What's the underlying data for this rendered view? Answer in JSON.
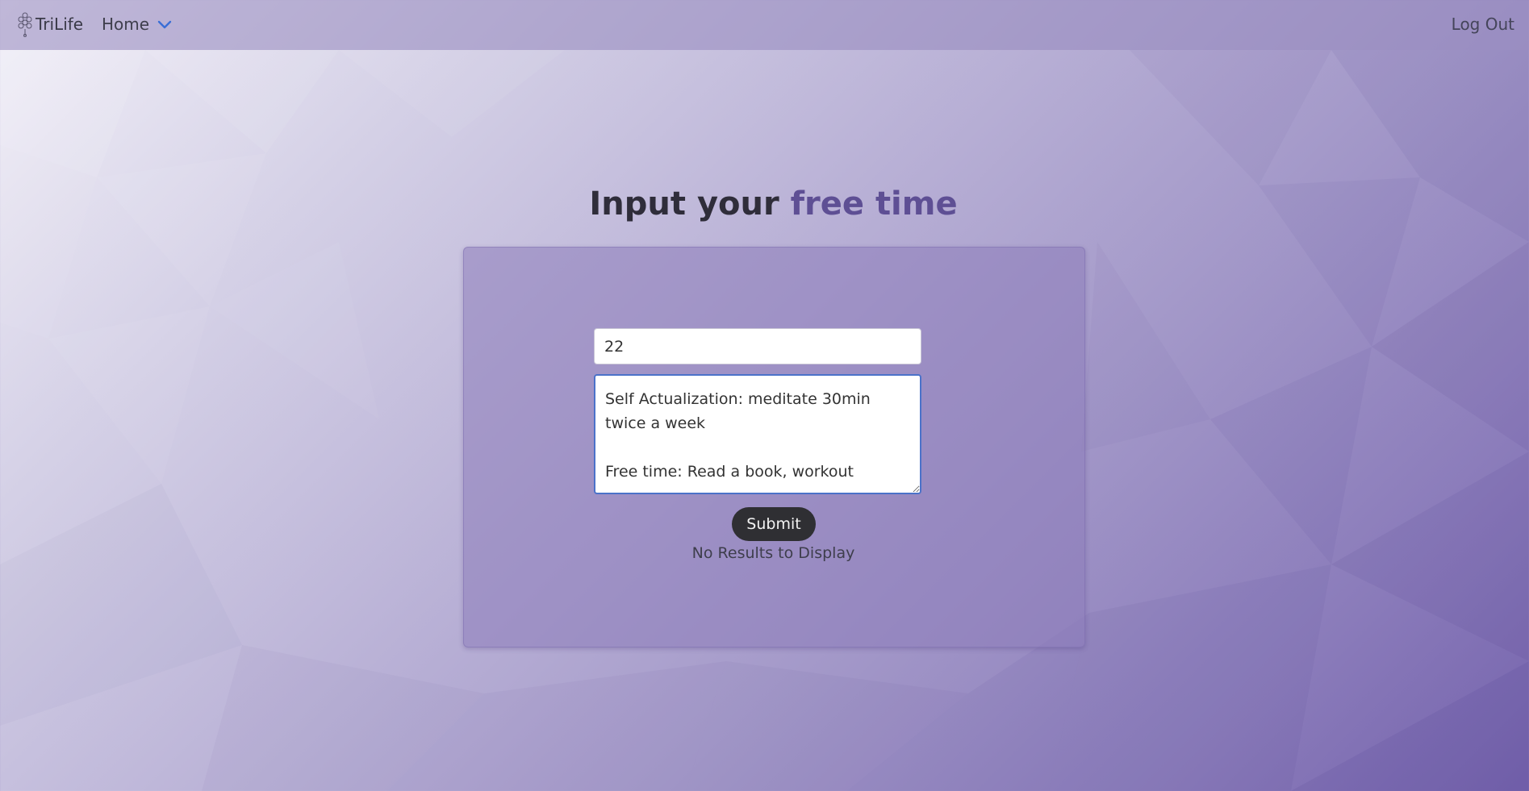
{
  "navbar": {
    "brand_name": "TriLife",
    "brand_icon": "lotus-logo-icon",
    "home_label": "Home",
    "home_dropdown_icon": "chevron-down-icon",
    "logout_label": "Log Out"
  },
  "main": {
    "title_prefix": "Input your ",
    "title_accent": "free time",
    "hours_value": "22",
    "goals_value": "Self Actualization: meditate 30min twice a week\n\nFree time: Read a book, workout",
    "submit_label": "Submit",
    "results_text": "No Results to Display"
  },
  "colors": {
    "title_accent": "#5e4f94",
    "submit_bg": "#2f2f33",
    "focus_border": "#4b72c9",
    "chevron": "#3b6fd6"
  }
}
